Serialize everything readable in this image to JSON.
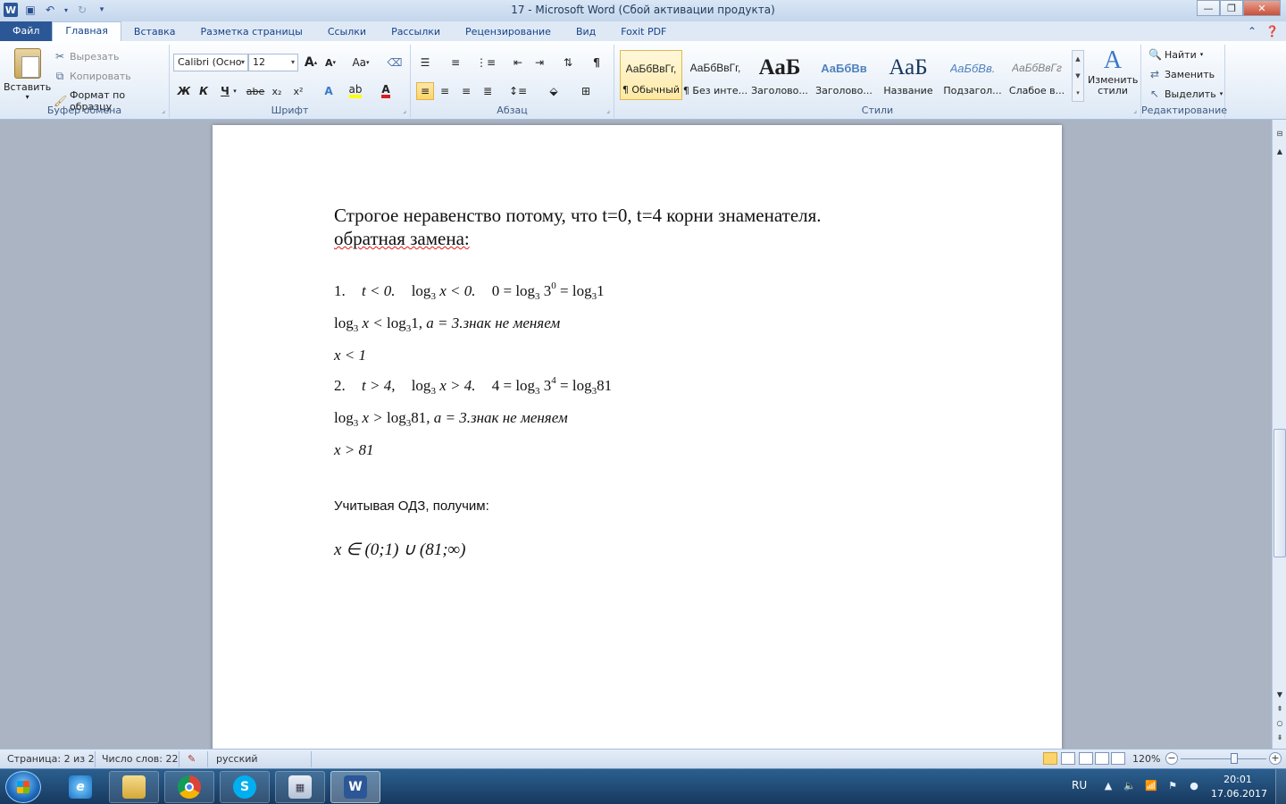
{
  "window": {
    "title": "17 - Microsoft Word (Сбой активации продукта)"
  },
  "tabs": [
    "Файл",
    "Главная",
    "Вставка",
    "Разметка страницы",
    "Ссылки",
    "Рассылки",
    "Рецензирование",
    "Вид",
    "Foxit PDF"
  ],
  "clipboard": {
    "paste": "Вставить",
    "cut": "Вырезать",
    "copy": "Копировать",
    "format_painter": "Формат по образцу",
    "label": "Буфер обмена"
  },
  "font": {
    "name": "Calibri (Осно",
    "size": "12",
    "label": "Шрифт",
    "bold": "Ж",
    "italic": "К",
    "underline": "Ч",
    "strike": "abe",
    "subscript": "x₂",
    "superscript": "x²",
    "grow": "A",
    "shrink": "A",
    "case": "Aa"
  },
  "paragraph": {
    "label": "Абзац"
  },
  "styles": {
    "label": "Стили",
    "items": [
      {
        "sample": "АаБбВвГг,",
        "name": "¶ Обычный"
      },
      {
        "sample": "АаБбВвГг,",
        "name": "¶ Без инте..."
      },
      {
        "sample": "АаБ",
        "name": "Заголово..."
      },
      {
        "sample": "АаБбВв",
        "name": "Заголово..."
      },
      {
        "sample": "АаБ",
        "name": "Название"
      },
      {
        "sample": "АаБбВв.",
        "name": "Подзагол..."
      },
      {
        "sample": "АаБбВвГг",
        "name": "Слабое в..."
      }
    ],
    "change_styles": "Изменить стили"
  },
  "editing": {
    "label": "Редактирование",
    "find": "Найти",
    "replace": "Заменить",
    "select": "Выделить"
  },
  "document": {
    "line1": "Строгое неравенство потому, что t=0, t=4 корни знаменателя.",
    "line2": "обратная замена:",
    "odz": "Учитывая ОДЗ, получим:",
    "math": {
      "n1": "1.",
      "n2": "2.",
      "log": "log",
      "b3": "3",
      "e0": "0",
      "e4": "4",
      "comma_a": ", a = 3",
      "note": ".знак не меняем",
      "x_lt_1": "x < 1",
      "x_gt_81": "x > 81",
      "t_lt_0": "t < 0.",
      "t_gt_4": "t > 4,",
      "x_lt_0": " x < 0.",
      "x_gt_4": " x > 4.",
      "zero_eq": "0 = ",
      "four_eq": "4 = ",
      "eq": " = ",
      "one": "1",
      "eightyone": "81",
      "x_lt": " x < ",
      "x_gt": " x > ",
      "answer": "x ∈ (0;1) ∪ (81;∞)"
    }
  },
  "status": {
    "page": "Страница: 2 из 2",
    "words": "Число слов: 22",
    "language": "русский",
    "zoom": "120%",
    "zoom_level": 0.62
  },
  "tray": {
    "lang": "RU",
    "time": "20:01",
    "date": "17.06.2017"
  }
}
